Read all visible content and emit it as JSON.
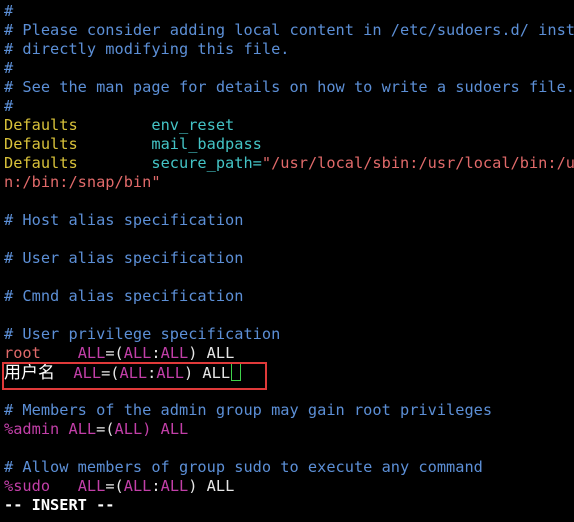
{
  "colors": {
    "background": "#000000",
    "comment": "#5c8fd6",
    "keyword": "#d9c23a",
    "option": "#44c4c6",
    "string": "#e16a6a",
    "user": "#c23fa8",
    "cursor": "#3fd24a",
    "highlight_box": "#e03a3a"
  },
  "lines": {
    "l1": "#",
    "l2": "# Please consider adding local content in /etc/sudoers.d/ instea",
    "l3": "# directly modifying this file.",
    "l4": "#",
    "l5": "# See the man page for details on how to write a sudoers file.",
    "l6": "#",
    "d1_key": "Defaults",
    "d1_val": "env_reset",
    "d2_key": "Defaults",
    "d2_val": "mail_badpass",
    "d3_key": "Defaults",
    "d3_opt": "secure_path=",
    "d3_str": "\"/usr/local/sbin:/usr/local/bin:/us",
    "d3_cont": "n:/bin:/snap/bin\"",
    "c_host": "# Host alias specification",
    "c_user": "# User alias specification",
    "c_cmnd": "# Cmnd alias specification",
    "c_priv": "# User privilege specification",
    "root_user": "root",
    "root_all1": "ALL",
    "root_eq": "=(",
    "root_all2": "ALL",
    "root_colon": ":",
    "root_all3": "ALL",
    "root_close": ") ALL",
    "new_user": "用户名",
    "new_all1": "ALL",
    "new_eq": "=(",
    "new_all2": "ALL",
    "new_colon": ":",
    "new_all3": "ALL",
    "new_close": ") ALL",
    "c_admin": "# Members of the admin group may gain root privileges",
    "admin_user": "%admin",
    "admin_all1": "ALL",
    "admin_eq": "=(",
    "admin_all2": "ALL",
    "admin_close": ") ALL",
    "c_sudo": "# Allow members of group sudo to execute any command",
    "sudo_user": "%sudo",
    "sudo_all1": "ALL",
    "sudo_eq": "=(",
    "sudo_all2": "ALL",
    "sudo_colon": ":",
    "sudo_all3": "ALL",
    "sudo_close": ") ALL"
  },
  "status": {
    "mode": "-- INSERT --"
  }
}
